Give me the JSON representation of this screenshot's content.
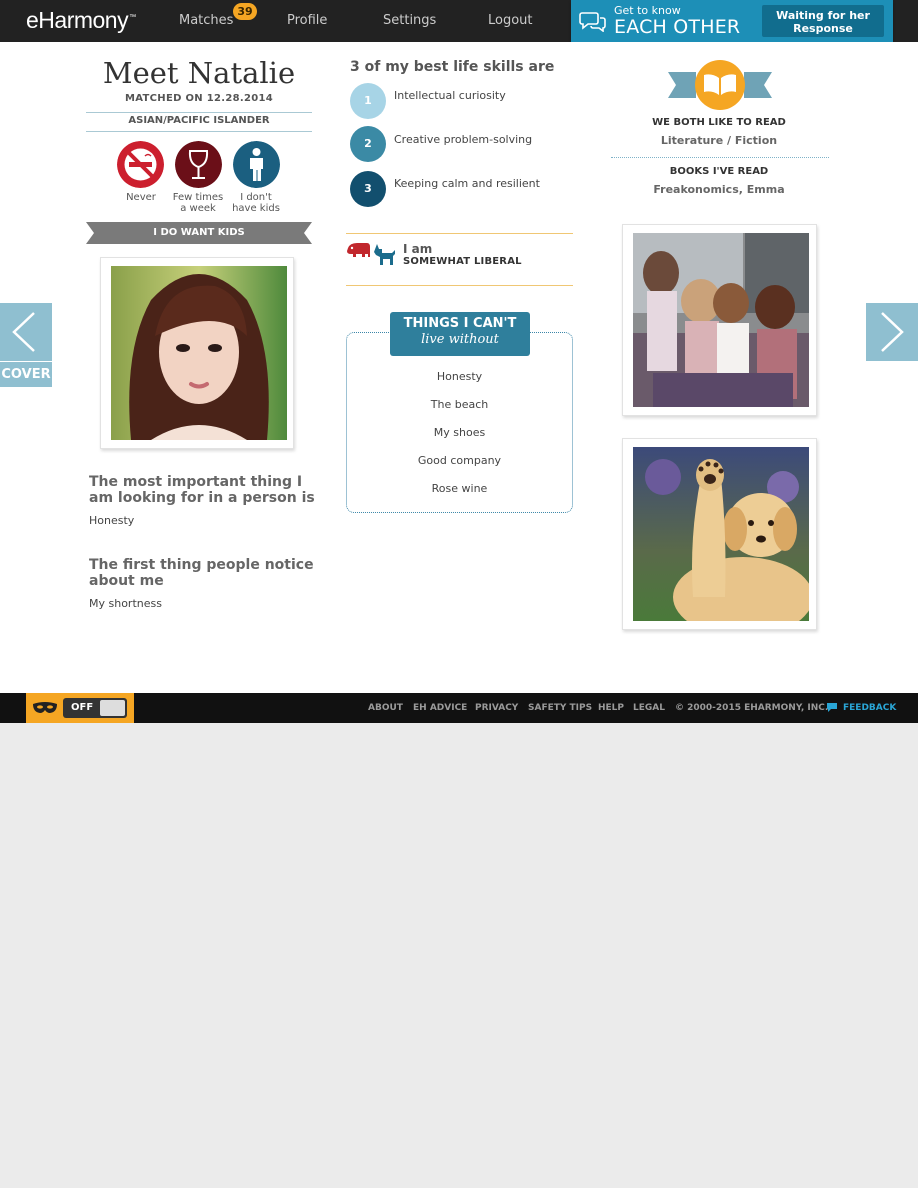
{
  "header": {
    "logo": "eHarmony",
    "logo_mark": "™",
    "nav": {
      "matches": "Matches",
      "matches_count": "39",
      "profile": "Profile",
      "settings": "Settings",
      "logout": "Logout"
    },
    "get_to_know": {
      "small": "Get to know",
      "big": "EACH OTHER",
      "status_line1": "Waiting for her",
      "status_line2": "Response"
    }
  },
  "profile": {
    "title": "Meet Natalie",
    "matched_on": "MATCHED ON 12.28.2014",
    "ethnicity": "ASIAN/PACIFIC ISLANDER",
    "lifestyle": [
      {
        "icon": "no-smoking-icon",
        "label": "Never",
        "color": "#cc1f2e"
      },
      {
        "icon": "wine-glass-icon",
        "label_line1": "Few times",
        "label_line2": "a week",
        "color": "#6b0f18"
      },
      {
        "icon": "person-icon",
        "label_line1": "I don't",
        "label_line2": "have kids",
        "color": "#1b5f80"
      }
    ],
    "kids_ribbon": "I DO WANT KIDS",
    "questions": [
      {
        "line1": "The most important thing I",
        "line2": "am looking for in a person is",
        "answer": "Honesty"
      },
      {
        "line1": "The first thing people notice",
        "line2": "about me",
        "answer": "My shortness"
      }
    ]
  },
  "skills": {
    "heading": "3 of my best life skills are",
    "items": [
      {
        "num": "1",
        "text": "Intellectual curiosity",
        "color": "#a7d4e6"
      },
      {
        "num": "2",
        "text": "Creative problem-solving",
        "color": "#3b8aa5"
      },
      {
        "num": "3",
        "text": "Keeping calm and resilient",
        "color": "#124f6e"
      }
    ]
  },
  "politics": {
    "line1": "I am",
    "line2": "SOMEWHAT LIBERAL"
  },
  "cant_live_without": {
    "title1": "THINGS I CAN'T",
    "title2": "live without",
    "items": [
      "Honesty",
      "The beach",
      "My shoes",
      "Good company",
      "Rose wine"
    ]
  },
  "reading": {
    "both_like_heading": "WE BOTH LIKE TO READ",
    "both_like_value": "Literature / Fiction",
    "books_heading": "BOOKS I'VE READ",
    "books_value": "Freakonomics, Emma"
  },
  "navigation": {
    "cover_label": "COVER"
  },
  "footer": {
    "toggle_state": "OFF",
    "links": {
      "about": "ABOUT",
      "eh_advice": "EH ADVICE",
      "privacy": "PRIVACY",
      "safety": "SAFETY TIPS",
      "help": "HELP",
      "legal": "LEGAL"
    },
    "copyright": "© 2000-2015 EHARMONY, INC.",
    "feedback": "FEEDBACK"
  },
  "colors": {
    "accent": "#1d8fb7",
    "badge": "#f5a623",
    "arrow": "#8fbfd0"
  }
}
